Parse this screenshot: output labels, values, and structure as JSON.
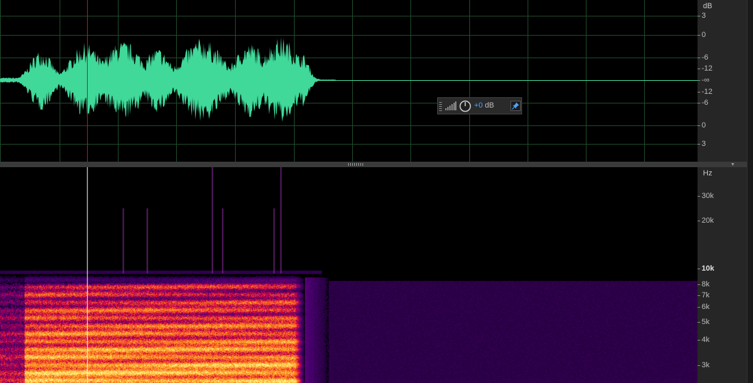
{
  "colors": {
    "waveform": "#40d99a",
    "grid": "#1f4a2a",
    "playhead_waveform": "#cc1111",
    "playhead_spectrogram": "#ffffff",
    "ruler_bg": "#262626",
    "hud_accent": "#4da3ff"
  },
  "db_ruler": {
    "unit": "dB",
    "labels": [
      "3",
      "0",
      "-6",
      "-12",
      "-∞",
      "-12",
      "-6",
      "0",
      "3"
    ]
  },
  "hz_ruler": {
    "unit": "Hz",
    "labels": [
      "30k",
      "20k",
      "10k",
      "8k",
      "7k",
      "6k",
      "5k",
      "4k",
      "3k"
    ]
  },
  "hud": {
    "value": "+0",
    "unit": "dB"
  },
  "icons": [
    "level-meter-icon",
    "gain-knob-icon",
    "pin-icon",
    "collapse-arrow-icon"
  ]
}
